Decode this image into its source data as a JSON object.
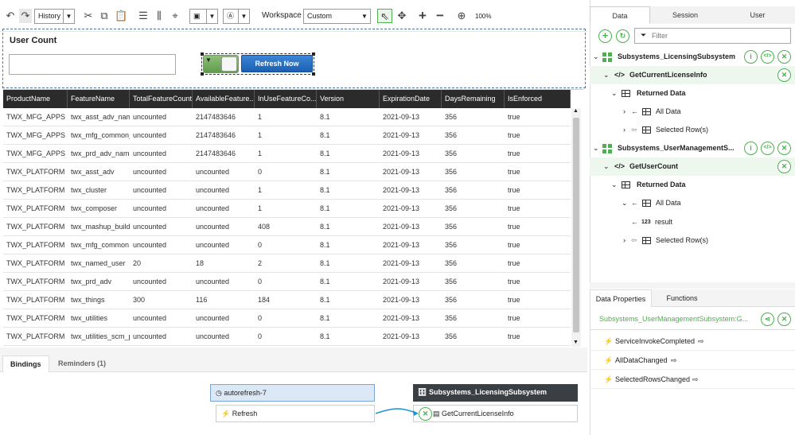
{
  "colors": {
    "accent": "#4caf50",
    "button": "#1b5fb3",
    "grid_header": "#2b2b2b"
  },
  "toolbar": {
    "history_label": "History",
    "workspace_label": "Workspace",
    "workspace_value": "Custom",
    "zoom": "100%"
  },
  "widget": {
    "title": "User Count",
    "refresh_label": "Refresh Now"
  },
  "grid": {
    "columns": [
      "ProductName",
      "FeatureName",
      "TotalFeatureCount",
      "AvailableFeature...",
      "InUseFeatureCo...",
      "Version",
      "ExpirationDate",
      "DaysRemaining",
      "IsEnforced"
    ],
    "rows": [
      [
        "TWX_MFG_APPS",
        "twx_asst_adv_name",
        "uncounted",
        "2147483646",
        "1",
        "8.1",
        "2021-09-13",
        "356",
        "true"
      ],
      [
        "TWX_MFG_APPS",
        "twx_mfg_common_r",
        "uncounted",
        "2147483646",
        "1",
        "8.1",
        "2021-09-13",
        "356",
        "true"
      ],
      [
        "TWX_MFG_APPS",
        "twx_prd_adv_namec",
        "uncounted",
        "2147483646",
        "1",
        "8.1",
        "2021-09-13",
        "356",
        "true"
      ],
      [
        "TWX_PLATFORM",
        "twx_asst_adv",
        "uncounted",
        "uncounted",
        "0",
        "8.1",
        "2021-09-13",
        "356",
        "true"
      ],
      [
        "TWX_PLATFORM",
        "twx_cluster",
        "uncounted",
        "uncounted",
        "1",
        "8.1",
        "2021-09-13",
        "356",
        "true"
      ],
      [
        "TWX_PLATFORM",
        "twx_composer",
        "uncounted",
        "uncounted",
        "1",
        "8.1",
        "2021-09-13",
        "356",
        "true"
      ],
      [
        "TWX_PLATFORM",
        "twx_mashup_builde",
        "uncounted",
        "uncounted",
        "408",
        "8.1",
        "2021-09-13",
        "356",
        "true"
      ],
      [
        "TWX_PLATFORM",
        "twx_mfg_common",
        "uncounted",
        "uncounted",
        "0",
        "8.1",
        "2021-09-13",
        "356",
        "true"
      ],
      [
        "TWX_PLATFORM",
        "twx_named_user",
        "20",
        "18",
        "2",
        "8.1",
        "2021-09-13",
        "356",
        "true"
      ],
      [
        "TWX_PLATFORM",
        "twx_prd_adv",
        "uncounted",
        "uncounted",
        "0",
        "8.1",
        "2021-09-13",
        "356",
        "true"
      ],
      [
        "TWX_PLATFORM",
        "twx_things",
        "300",
        "116",
        "184",
        "8.1",
        "2021-09-13",
        "356",
        "true"
      ],
      [
        "TWX_PLATFORM",
        "twx_utilities",
        "uncounted",
        "uncounted",
        "0",
        "8.1",
        "2021-09-13",
        "356",
        "true"
      ],
      [
        "TWX_PLATFORM",
        "twx_utilities_scm_pa",
        "uncounted",
        "uncounted",
        "0",
        "8.1",
        "2021-09-13",
        "356",
        "true"
      ]
    ]
  },
  "bottom": {
    "tabs": [
      "Bindings",
      "Reminders (1)"
    ],
    "autorefresh": "autorefresh-7",
    "refresh_event": "Refresh",
    "data_source": "Subsystems_LicensingSubsystem",
    "service": "GetCurrentLicenseInfo"
  },
  "right_panel": {
    "tabs": [
      "Data",
      "Session",
      "User"
    ],
    "filter_placeholder": "Filter",
    "tree": {
      "ds1": "Subsystems_LicensingSubsystem",
      "svc1": "GetCurrentLicenseInfo",
      "returned1": "Returned Data",
      "all1": "All Data",
      "selected1": "Selected Row(s)",
      "ds2": "Subsystems_UserManagementS...",
      "svc2": "GetUserCount",
      "returned2": "Returned Data",
      "all2": "All Data",
      "result_type": "123",
      "result": "result",
      "selected2": "Selected Row(s)"
    },
    "bottom_tabs": [
      "Data Properties",
      "Functions"
    ],
    "selected_service": "Subsystems_UserManagementSubsystem:G...",
    "events": [
      "ServiceInvokeCompleted",
      "AllDataChanged",
      "SelectedRowsChanged"
    ]
  }
}
